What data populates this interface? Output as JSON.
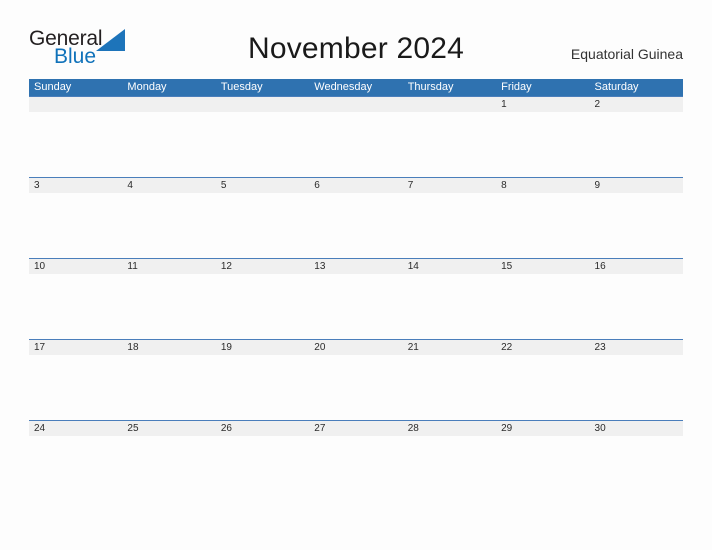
{
  "brand": {
    "word_one": "General",
    "word_two": "Blue",
    "triangle_icon": "brand-triangle-icon"
  },
  "header": {
    "title": "November 2024",
    "region": "Equatorial Guinea"
  },
  "calendar": {
    "weekday_headers": [
      "Sunday",
      "Monday",
      "Tuesday",
      "Wednesday",
      "Thursday",
      "Friday",
      "Saturday"
    ],
    "weeks": [
      [
        "",
        "",
        "",
        "",
        "",
        "1",
        "2"
      ],
      [
        "3",
        "4",
        "5",
        "6",
        "7",
        "8",
        "9"
      ],
      [
        "10",
        "11",
        "12",
        "13",
        "14",
        "15",
        "16"
      ],
      [
        "17",
        "18",
        "19",
        "20",
        "21",
        "22",
        "23"
      ],
      [
        "24",
        "25",
        "26",
        "27",
        "28",
        "29",
        "30"
      ]
    ]
  },
  "colors": {
    "header_blue": "#2f72b0",
    "row_separator_blue": "#4a7ebb",
    "row_band_gray": "#f0f0f0",
    "brand_blue": "#1072ba",
    "page_background": "#fdfdfd"
  }
}
